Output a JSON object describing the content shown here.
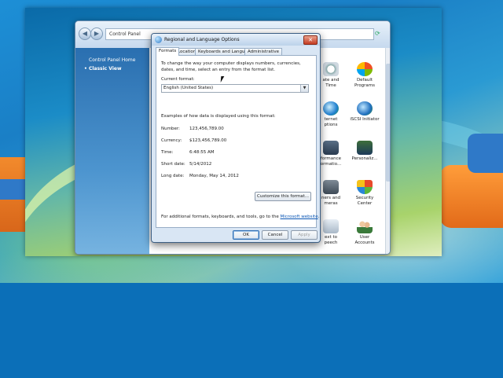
{
  "control_panel": {
    "address": "Control Panel",
    "sidebar": {
      "home_label": "Control Panel Home",
      "classic_view_label": "Classic View"
    },
    "items": [
      {
        "label": "Date and Time",
        "icon": "clock-icon"
      },
      {
        "label": "Default Programs",
        "icon": "default-programs-icon"
      },
      {
        "label": "Internet Options",
        "icon": "globe-icon"
      },
      {
        "label": "iSCSI Initiator",
        "icon": "iscsi-icon"
      },
      {
        "label": "Performance Information",
        "icon": "performance-icon"
      },
      {
        "label": "Personaliz...",
        "icon": "personalization-icon"
      },
      {
        "label": "Scanners and Cameras",
        "icon": "scanner-icon"
      },
      {
        "label": "Security Center",
        "icon": "shield-icon"
      },
      {
        "label": "Text to Speech",
        "icon": "speech-icon"
      },
      {
        "label": "User Accounts",
        "icon": "users-icon"
      }
    ],
    "visible_labels": {
      "date_time": [
        "ate and",
        "Time"
      ],
      "default_programs": [
        "Default",
        "Programs"
      ],
      "internet": [
        "ternet",
        "ptions"
      ],
      "iscsi": "iSCSI Initiator",
      "performance": [
        "formance",
        "ormatio..."
      ],
      "personalization": "Personaliz...",
      "scanners": [
        "ners and",
        "meras"
      ],
      "security": [
        "Security",
        "Center"
      ],
      "speech": [
        "ext to",
        "peech"
      ],
      "users": [
        "User",
        "Accounts"
      ]
    }
  },
  "dialog": {
    "title": "Regional and Language Options",
    "close_label": "✕",
    "tabs": [
      {
        "label": "Formats",
        "active": true
      },
      {
        "label": "Location",
        "active": false
      },
      {
        "label": "Keyboards and Languages",
        "active": false
      },
      {
        "label": "Administrative",
        "active": false
      }
    ],
    "intro": "To change the way your computer displays numbers, currencies, dates, and time, select an entry from the format list.",
    "current_format_label": "Current format:",
    "current_format_value": "English (United States)",
    "examples_title": "Examples of how data is displayed using this format:",
    "examples": [
      {
        "label": "Number:",
        "value": "123,456,789.00"
      },
      {
        "label": "Currency:",
        "value": "$123,456,789.00"
      },
      {
        "label": "Time:",
        "value": "6:48:55 AM"
      },
      {
        "label": "Short date:",
        "value": "5/14/2012"
      },
      {
        "label": "Long date:",
        "value": "Monday, May 14, 2012"
      }
    ],
    "customize_label": "Customize this format...",
    "additional_text": "For additional formats, keyboards, and tools, go to the ",
    "additional_link": "Microsoft website",
    "additional_end": ".",
    "ok_label": "OK",
    "cancel_label": "Cancel",
    "apply_label": "Apply"
  }
}
